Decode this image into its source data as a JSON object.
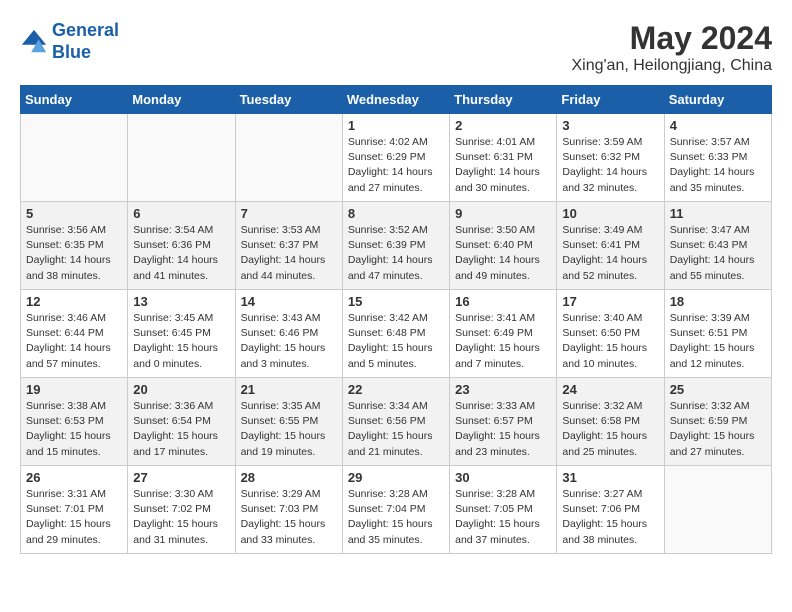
{
  "logo": {
    "line1": "General",
    "line2": "Blue"
  },
  "title": "May 2024",
  "subtitle": "Xing'an, Heilongjiang, China",
  "headers": [
    "Sunday",
    "Monday",
    "Tuesday",
    "Wednesday",
    "Thursday",
    "Friday",
    "Saturday"
  ],
  "weeks": [
    [
      {
        "num": "",
        "info": ""
      },
      {
        "num": "",
        "info": ""
      },
      {
        "num": "",
        "info": ""
      },
      {
        "num": "1",
        "info": "Sunrise: 4:02 AM\nSunset: 6:29 PM\nDaylight: 14 hours\nand 27 minutes."
      },
      {
        "num": "2",
        "info": "Sunrise: 4:01 AM\nSunset: 6:31 PM\nDaylight: 14 hours\nand 30 minutes."
      },
      {
        "num": "3",
        "info": "Sunrise: 3:59 AM\nSunset: 6:32 PM\nDaylight: 14 hours\nand 32 minutes."
      },
      {
        "num": "4",
        "info": "Sunrise: 3:57 AM\nSunset: 6:33 PM\nDaylight: 14 hours\nand 35 minutes."
      }
    ],
    [
      {
        "num": "5",
        "info": "Sunrise: 3:56 AM\nSunset: 6:35 PM\nDaylight: 14 hours\nand 38 minutes."
      },
      {
        "num": "6",
        "info": "Sunrise: 3:54 AM\nSunset: 6:36 PM\nDaylight: 14 hours\nand 41 minutes."
      },
      {
        "num": "7",
        "info": "Sunrise: 3:53 AM\nSunset: 6:37 PM\nDaylight: 14 hours\nand 44 minutes."
      },
      {
        "num": "8",
        "info": "Sunrise: 3:52 AM\nSunset: 6:39 PM\nDaylight: 14 hours\nand 47 minutes."
      },
      {
        "num": "9",
        "info": "Sunrise: 3:50 AM\nSunset: 6:40 PM\nDaylight: 14 hours\nand 49 minutes."
      },
      {
        "num": "10",
        "info": "Sunrise: 3:49 AM\nSunset: 6:41 PM\nDaylight: 14 hours\nand 52 minutes."
      },
      {
        "num": "11",
        "info": "Sunrise: 3:47 AM\nSunset: 6:43 PM\nDaylight: 14 hours\nand 55 minutes."
      }
    ],
    [
      {
        "num": "12",
        "info": "Sunrise: 3:46 AM\nSunset: 6:44 PM\nDaylight: 14 hours\nand 57 minutes."
      },
      {
        "num": "13",
        "info": "Sunrise: 3:45 AM\nSunset: 6:45 PM\nDaylight: 15 hours\nand 0 minutes."
      },
      {
        "num": "14",
        "info": "Sunrise: 3:43 AM\nSunset: 6:46 PM\nDaylight: 15 hours\nand 3 minutes."
      },
      {
        "num": "15",
        "info": "Sunrise: 3:42 AM\nSunset: 6:48 PM\nDaylight: 15 hours\nand 5 minutes."
      },
      {
        "num": "16",
        "info": "Sunrise: 3:41 AM\nSunset: 6:49 PM\nDaylight: 15 hours\nand 7 minutes."
      },
      {
        "num": "17",
        "info": "Sunrise: 3:40 AM\nSunset: 6:50 PM\nDaylight: 15 hours\nand 10 minutes."
      },
      {
        "num": "18",
        "info": "Sunrise: 3:39 AM\nSunset: 6:51 PM\nDaylight: 15 hours\nand 12 minutes."
      }
    ],
    [
      {
        "num": "19",
        "info": "Sunrise: 3:38 AM\nSunset: 6:53 PM\nDaylight: 15 hours\nand 15 minutes."
      },
      {
        "num": "20",
        "info": "Sunrise: 3:36 AM\nSunset: 6:54 PM\nDaylight: 15 hours\nand 17 minutes."
      },
      {
        "num": "21",
        "info": "Sunrise: 3:35 AM\nSunset: 6:55 PM\nDaylight: 15 hours\nand 19 minutes."
      },
      {
        "num": "22",
        "info": "Sunrise: 3:34 AM\nSunset: 6:56 PM\nDaylight: 15 hours\nand 21 minutes."
      },
      {
        "num": "23",
        "info": "Sunrise: 3:33 AM\nSunset: 6:57 PM\nDaylight: 15 hours\nand 23 minutes."
      },
      {
        "num": "24",
        "info": "Sunrise: 3:32 AM\nSunset: 6:58 PM\nDaylight: 15 hours\nand 25 minutes."
      },
      {
        "num": "25",
        "info": "Sunrise: 3:32 AM\nSunset: 6:59 PM\nDaylight: 15 hours\nand 27 minutes."
      }
    ],
    [
      {
        "num": "26",
        "info": "Sunrise: 3:31 AM\nSunset: 7:01 PM\nDaylight: 15 hours\nand 29 minutes."
      },
      {
        "num": "27",
        "info": "Sunrise: 3:30 AM\nSunset: 7:02 PM\nDaylight: 15 hours\nand 31 minutes."
      },
      {
        "num": "28",
        "info": "Sunrise: 3:29 AM\nSunset: 7:03 PM\nDaylight: 15 hours\nand 33 minutes."
      },
      {
        "num": "29",
        "info": "Sunrise: 3:28 AM\nSunset: 7:04 PM\nDaylight: 15 hours\nand 35 minutes."
      },
      {
        "num": "30",
        "info": "Sunrise: 3:28 AM\nSunset: 7:05 PM\nDaylight: 15 hours\nand 37 minutes."
      },
      {
        "num": "31",
        "info": "Sunrise: 3:27 AM\nSunset: 7:06 PM\nDaylight: 15 hours\nand 38 minutes."
      },
      {
        "num": "",
        "info": ""
      }
    ]
  ],
  "colors": {
    "header_bg": "#1a5fa8",
    "shaded_row": "#f2f2f2"
  }
}
